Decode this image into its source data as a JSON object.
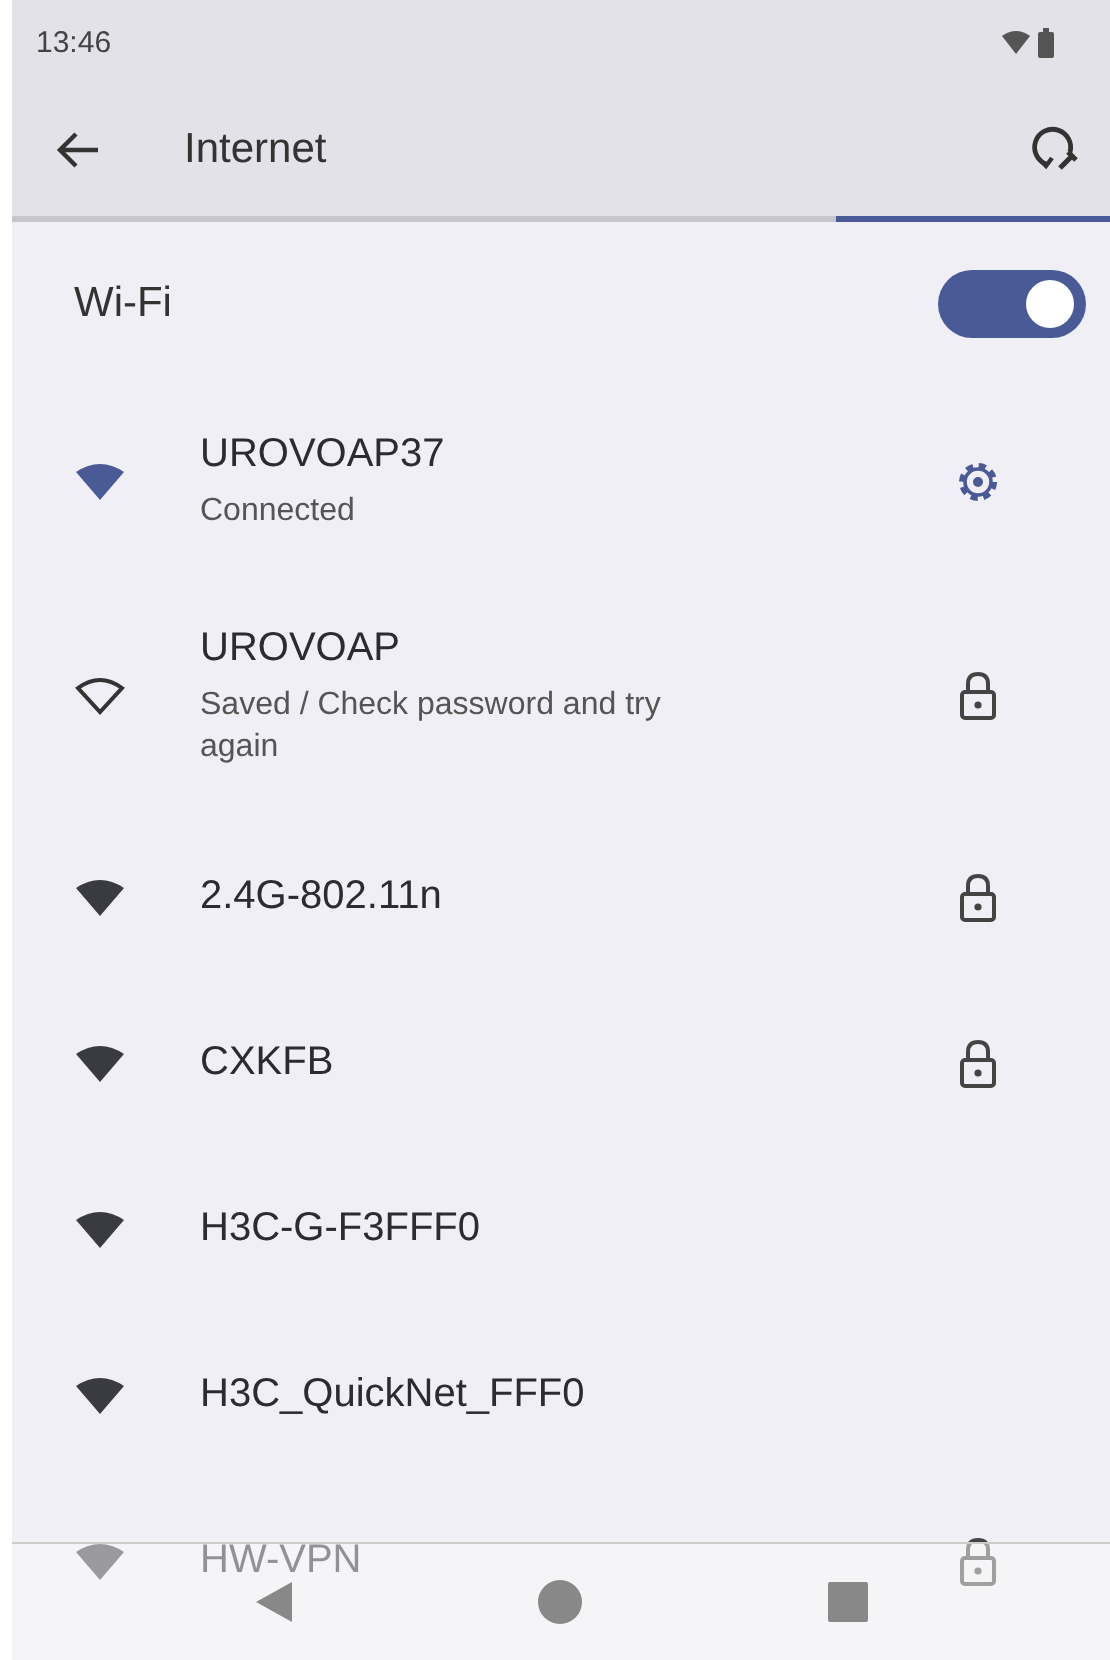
{
  "status_bar": {
    "time": "13:46"
  },
  "app_bar": {
    "title": "Internet"
  },
  "progress": {
    "level": 0.25
  },
  "wifi": {
    "label": "Wi-Fi",
    "on": true
  },
  "networks": [
    {
      "name": "UROVOAP37",
      "status": "Connected",
      "connected": true
    },
    {
      "name": "UROVOAP",
      "status": "Saved / Check password and try again",
      "connected": false,
      "saved": true,
      "secured": true
    },
    {
      "name": "2.4G-802.11n",
      "connected": false,
      "saved": false,
      "secured": true
    },
    {
      "name": "CXKFB",
      "connected": false,
      "saved": false,
      "secured": true
    },
    {
      "name": "H3C-G-F3FFF0",
      "connected": false,
      "saved": false,
      "secured": false
    },
    {
      "name": "H3C_QuickNet_FFF0",
      "connected": false,
      "saved": false,
      "secured": false
    },
    {
      "name": "HW-VPN",
      "connected": false,
      "saved": false,
      "secured": true
    }
  ]
}
